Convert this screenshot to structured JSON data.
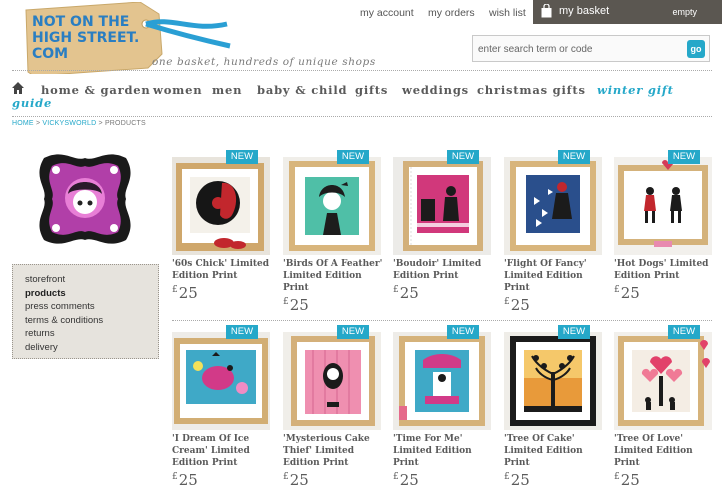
{
  "header": {
    "logo_text": [
      "NOT ON THE",
      "HIGH STREET.",
      "COM"
    ],
    "tagline": "one basket, hundreds of unique shops",
    "top_links": [
      "my account",
      "my orders",
      "wish list"
    ],
    "basket_label": "my basket",
    "basket_status": "empty",
    "search_placeholder": "enter search term or code",
    "search_button": "go"
  },
  "nav": {
    "items": [
      "home & garden",
      "women",
      "men",
      "baby & child",
      "gifts",
      "weddings",
      "christmas gifts"
    ],
    "highlight_line1": "winter gift",
    "highlight_line2": "guide"
  },
  "breadcrumb": [
    "HOME",
    "VICKYSWORLD",
    "PRODUCTS"
  ],
  "sidebar": {
    "items": [
      "storefront",
      "products",
      "press comments",
      "terms & conditions",
      "returns",
      "delivery"
    ]
  },
  "products": [
    {
      "badge": "NEW",
      "title": "'60s Chick' Limited Edition Print",
      "currency": "£",
      "price": "25"
    },
    {
      "badge": "NEW",
      "title": "'Birds Of A Feather' Limited Edition Print",
      "currency": "£",
      "price": "25"
    },
    {
      "badge": "NEW",
      "title": "'Boudoir' Limited Edition Print",
      "currency": "£",
      "price": "25"
    },
    {
      "badge": "NEW",
      "title": "'Flight Of Fancy' Limited Edition Print",
      "currency": "£",
      "price": "25"
    },
    {
      "badge": "NEW",
      "title": "'Hot Dogs' Limited Edition Print",
      "currency": "£",
      "price": "25"
    },
    {
      "badge": "NEW",
      "title": "'I Dream Of Ice Cream' Limited Edition Print",
      "currency": "£",
      "price": "25"
    },
    {
      "badge": "NEW",
      "title": "'Mysterious Cake Thief' Limited Edition Print",
      "currency": "£",
      "price": "25"
    },
    {
      "badge": "NEW",
      "title": "'Time For Me' Limited Edition Print",
      "currency": "£",
      "price": "25"
    },
    {
      "badge": "NEW",
      "title": "'Tree Of Cake' Limited Edition Print",
      "currency": "£",
      "price": "25"
    },
    {
      "badge": "NEW",
      "title": "'Tree Of Love' Limited Edition Print",
      "currency": "£",
      "price": "25"
    }
  ],
  "colors": {
    "accent": "#25a8c9",
    "basket_bar": "#5b5751",
    "logo_tag": "#e3c48f",
    "text_grey": "#5a5a5a"
  },
  "icons": {
    "home": "home-icon",
    "basket": "shopping-bag-icon",
    "search_go": "go-button"
  }
}
